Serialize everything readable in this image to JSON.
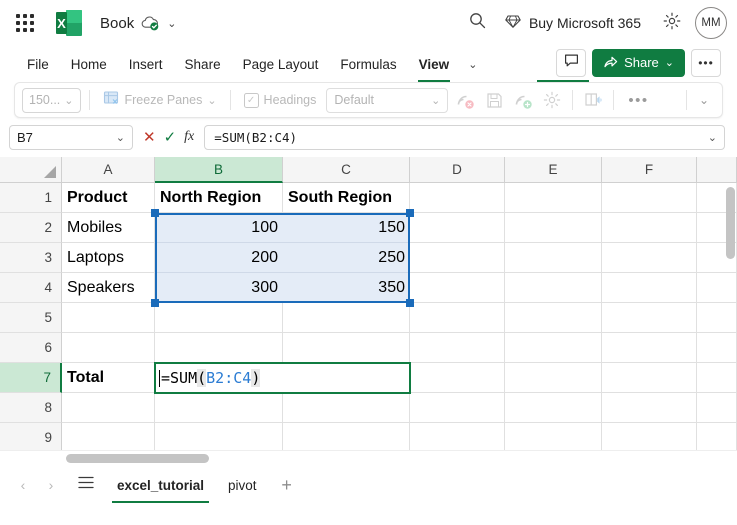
{
  "titlebar": {
    "app_launcher": "waffle-grid",
    "app_logo_letter": "X",
    "document_title": "Book",
    "save_state_icon": "cloud-saved-icon",
    "title_chevron": "⌄",
    "search_icon": "search-icon",
    "buy_label": "Buy Microsoft 365",
    "buy_icon": "diamond-icon",
    "settings_icon": "gear-icon",
    "avatar_initials": "MM"
  },
  "ribbon": {
    "tabs": [
      {
        "label": "File",
        "active": false
      },
      {
        "label": "Home",
        "active": false
      },
      {
        "label": "Insert",
        "active": false
      },
      {
        "label": "Share",
        "active": false
      },
      {
        "label": "Page Layout",
        "active": false
      },
      {
        "label": "Formulas",
        "active": false
      },
      {
        "label": "View",
        "active": true
      }
    ],
    "overflow_chevron": "⌄",
    "comment_icon": "comment-icon",
    "share_label": "Share",
    "share_icon": "share-icon",
    "share_chevron": "⌄",
    "more_options": "•••",
    "accent_color": "#107c41"
  },
  "toolbar": {
    "zoom_value": "150...",
    "zoom_chevron": "⌄",
    "freeze_panes_label": "Freeze Panes",
    "freeze_panes_icon": "freeze-panes-icon",
    "freeze_panes_chevron": "⌄",
    "headings_label": "Headings",
    "headings_checked": "✓",
    "gridline_style_value": "Default",
    "gridline_style_chevron": "⌄",
    "icons": [
      "stop-recording-icon",
      "save-icon",
      "record-macro-icon",
      "macro-settings-icon",
      "immersive-reader-icon"
    ],
    "more_dots": "•••",
    "collapse_chevron": "⌄"
  },
  "formula_bar": {
    "name_box_value": "B7",
    "name_box_chevron": "⌄",
    "cancel_icon": "✕",
    "confirm_icon": "✓",
    "function_icon": "fx",
    "formula_value": "=SUM(B2:C4)",
    "expand_chevron": "⌄"
  },
  "grid": {
    "columns": [
      {
        "label": "A",
        "width": 93,
        "selected": false
      },
      {
        "label": "B",
        "width": 128,
        "selected": true
      },
      {
        "label": "C",
        "width": 127,
        "selected": false
      },
      {
        "label": "D",
        "width": 95,
        "selected": false
      },
      {
        "label": "E",
        "width": 97,
        "selected": false
      },
      {
        "label": "F",
        "width": 95,
        "selected": false
      },
      {
        "label": "",
        "width": 40,
        "selected": false
      }
    ],
    "rows": [
      {
        "label": "1",
        "selected": false
      },
      {
        "label": "2",
        "selected": false
      },
      {
        "label": "3",
        "selected": false
      },
      {
        "label": "4",
        "selected": false
      },
      {
        "label": "5",
        "selected": false
      },
      {
        "label": "6",
        "selected": false
      },
      {
        "label": "7",
        "selected": true
      },
      {
        "label": "8",
        "selected": false
      },
      {
        "label": "9",
        "selected": false
      }
    ],
    "cells": [
      {
        "row": 0,
        "col": 0,
        "value": "Product",
        "bold": true,
        "align": "left"
      },
      {
        "row": 0,
        "col": 1,
        "value": "North Region",
        "bold": true,
        "align": "left"
      },
      {
        "row": 0,
        "col": 2,
        "value": "South Region",
        "bold": true,
        "align": "left"
      },
      {
        "row": 1,
        "col": 0,
        "value": "Mobiles",
        "bold": false,
        "align": "left"
      },
      {
        "row": 1,
        "col": 1,
        "value": "100",
        "bold": false,
        "align": "right",
        "selected": true
      },
      {
        "row": 1,
        "col": 2,
        "value": "150",
        "bold": false,
        "align": "right",
        "selected": true
      },
      {
        "row": 2,
        "col": 0,
        "value": "Laptops",
        "bold": false,
        "align": "left"
      },
      {
        "row": 2,
        "col": 1,
        "value": "200",
        "bold": false,
        "align": "right",
        "selected": true
      },
      {
        "row": 2,
        "col": 2,
        "value": "250",
        "bold": false,
        "align": "right",
        "selected": true
      },
      {
        "row": 3,
        "col": 0,
        "value": "Speakers",
        "bold": false,
        "align": "left"
      },
      {
        "row": 3,
        "col": 1,
        "value": "300",
        "bold": false,
        "align": "right",
        "selected": true
      },
      {
        "row": 3,
        "col": 2,
        "value": "350",
        "bold": false,
        "align": "right",
        "selected": true
      },
      {
        "row": 6,
        "col": 0,
        "value": "Total",
        "bold": true,
        "align": "left"
      }
    ],
    "selection_range": "B2:C4",
    "selection_border_color": "#1a6bba",
    "selection_fill_color": "#e4ecf7",
    "active_cell": "B7",
    "cell_editor": {
      "prefix": "=SUM",
      "open_paren": "(",
      "reference": "B2:C4",
      "close_paren": ")",
      "border_color": "#107c41",
      "reference_color": "#2b7cd3"
    }
  },
  "sheetbar": {
    "prev_icon": "‹",
    "next_icon": "›",
    "all_sheets_icon": "hamburger-icon",
    "tabs": [
      {
        "label": "excel_tutorial",
        "active": true
      },
      {
        "label": "pivot",
        "active": false
      }
    ],
    "add_sheet_icon": "+"
  }
}
